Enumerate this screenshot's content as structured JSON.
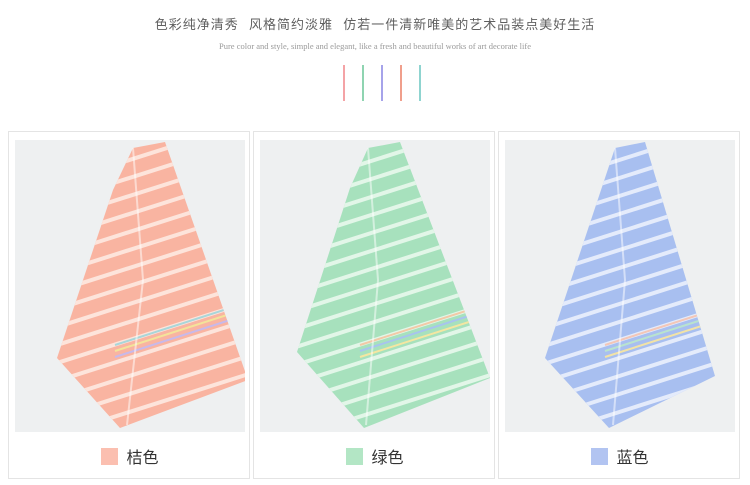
{
  "header": {
    "title": "色彩纯净清秀  风格简约淡雅  仿若一件清新唯美的艺术品装点美好生活",
    "subtitle": "Pure color and style, simple and elegant, like a fresh and beautiful works of art decorate life",
    "stripe_colors": [
      "#f4a3a6",
      "#8fd4b1",
      "#a6a3ea",
      "#f09f8c",
      "#8fd4d0"
    ]
  },
  "products": [
    {
      "label": "桔色",
      "swatch": "#fbbfb0",
      "towel": "#f9b4a1",
      "stripe": "#fde4db",
      "accent": [
        "#a9d6d9",
        "#f3e39a",
        "#c7b9ea"
      ]
    },
    {
      "label": "绿色",
      "swatch": "#b3e6c5",
      "towel": "#a7e1bd",
      "stripe": "#e2f6e8",
      "accent": [
        "#f2c9a6",
        "#a7c4ee",
        "#f4e6a1"
      ]
    },
    {
      "label": "蓝色",
      "swatch": "#b2c4f1",
      "towel": "#a8bff0",
      "stripe": "#e4ebfb",
      "accent": [
        "#f3c6b7",
        "#b9e3cf",
        "#f2e3a6"
      ]
    }
  ]
}
